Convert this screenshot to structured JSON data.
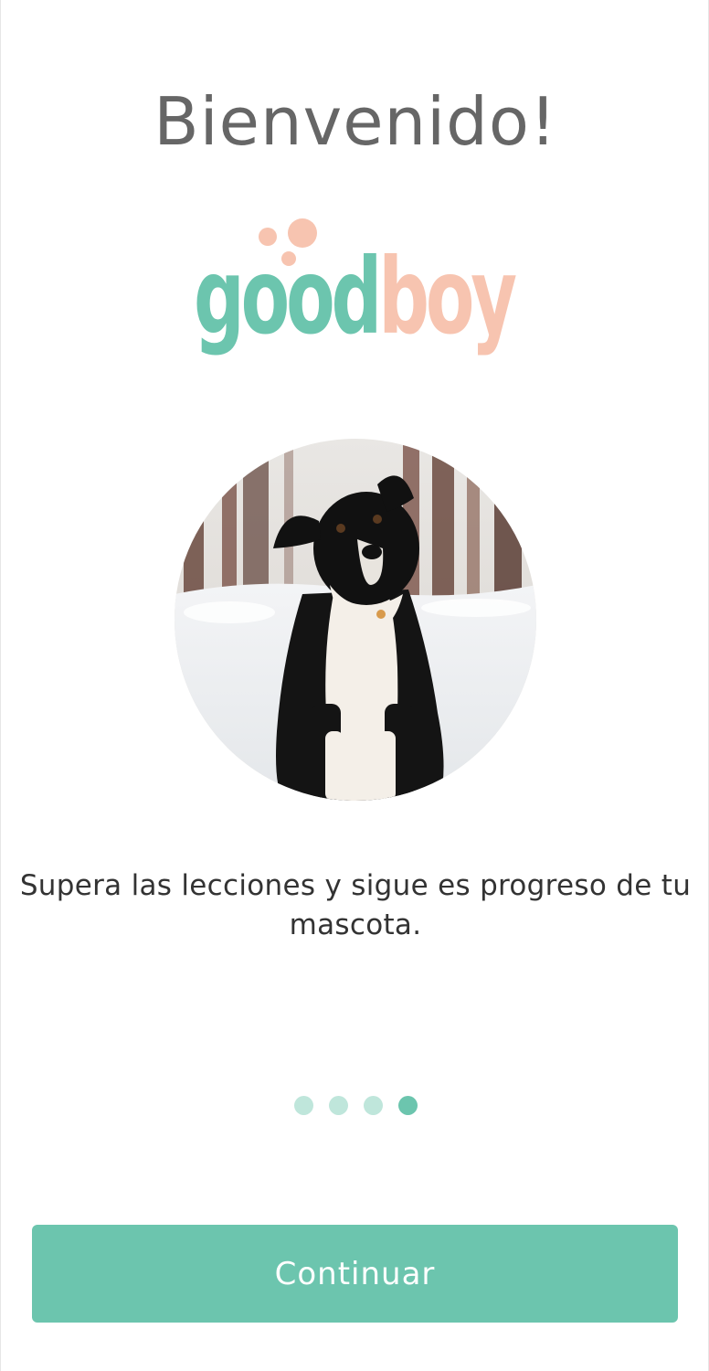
{
  "screen": {
    "title": "Bienvenido!",
    "description": "Supera las lecciones y sigue es progreso de tu mascota.",
    "continue_label": "Continuar"
  },
  "logo": {
    "text_part1": "good",
    "text_part2": "boy",
    "color_part1": "#6cc5ae",
    "color_part2": "#f7c4b0"
  },
  "photo": {
    "subject": "black-and-white-dog-in-snow"
  },
  "pagination": {
    "total": 4,
    "active_index": 3,
    "active_color": "#6cc5ae",
    "inactive_color": "#bfe6db"
  },
  "colors": {
    "accent": "#6cc5ae",
    "title_text": "#666666",
    "body_text": "#333333"
  }
}
